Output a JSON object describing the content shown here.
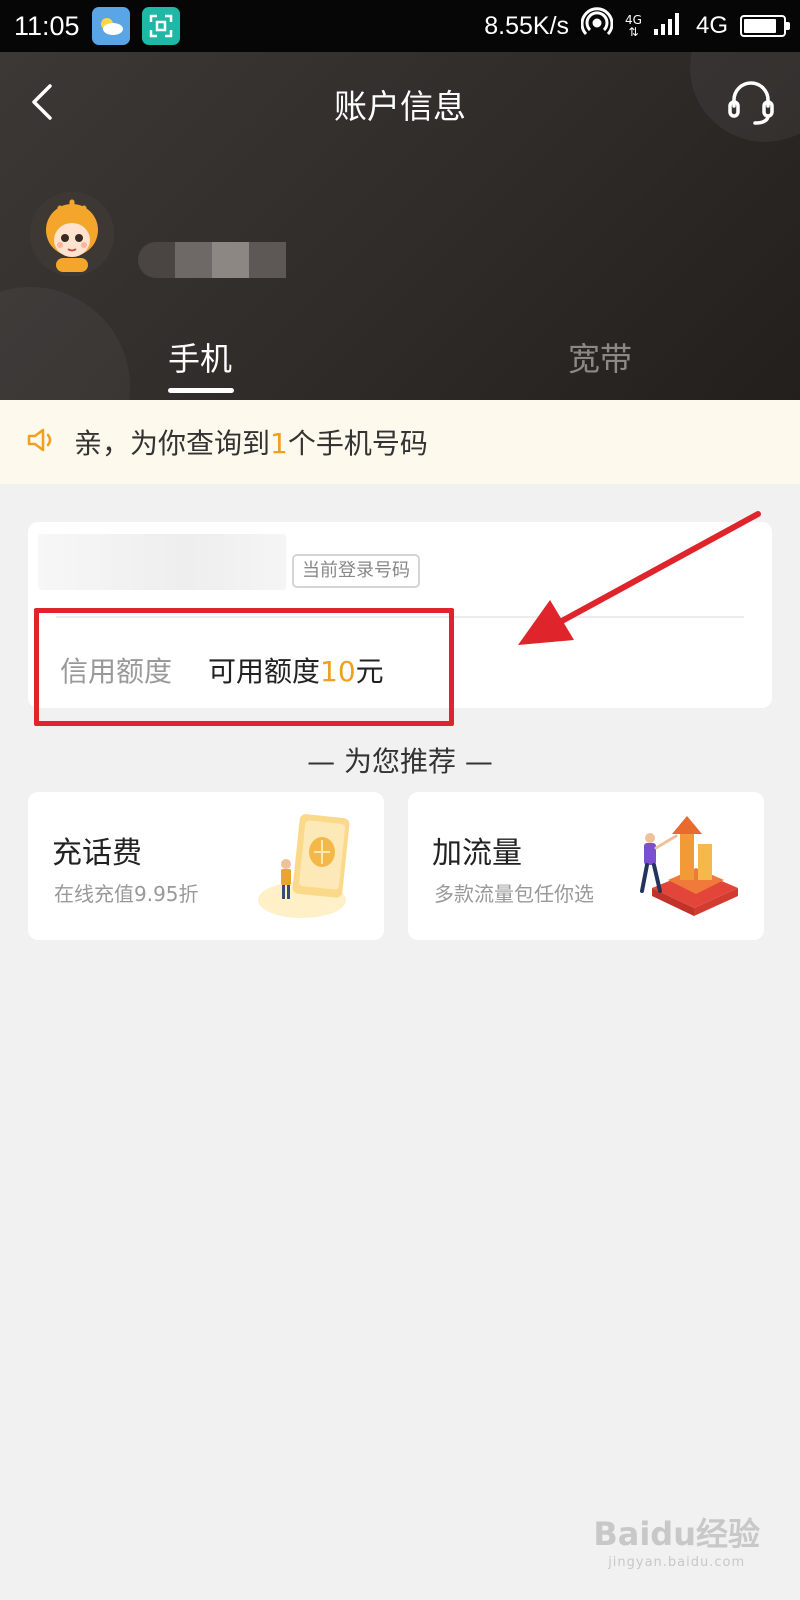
{
  "status_bar": {
    "time": "11:05",
    "net_speed": "8.55K/s",
    "network_small": "4G",
    "network": "4G"
  },
  "header": {
    "title": "账户信息",
    "tabs": [
      {
        "label": "手机",
        "active": true
      },
      {
        "label": "宽带",
        "active": false
      }
    ]
  },
  "notice": {
    "prefix": "亲，为你查询到",
    "count": "1",
    "suffix": "个手机号码"
  },
  "account_card": {
    "login_tag": "当前登录号码",
    "credit_label": "信用额度",
    "credit_prefix": "可用额度",
    "credit_amount": "10",
    "credit_unit": "元"
  },
  "recommend": {
    "title": "— 为您推荐 —",
    "items": [
      {
        "name": "充话费",
        "desc": "在线充值9.95折",
        "icon": "recharge-illustration"
      },
      {
        "name": "加流量",
        "desc": "多款流量包任你选",
        "icon": "data-illustration"
      }
    ]
  },
  "watermark": {
    "main": "Baidu经验",
    "sub": "jingyan.baidu.com"
  },
  "colors": {
    "accent": "#f0a020",
    "highlight_red": "#e0242b",
    "header_bg": "#332f2d"
  }
}
